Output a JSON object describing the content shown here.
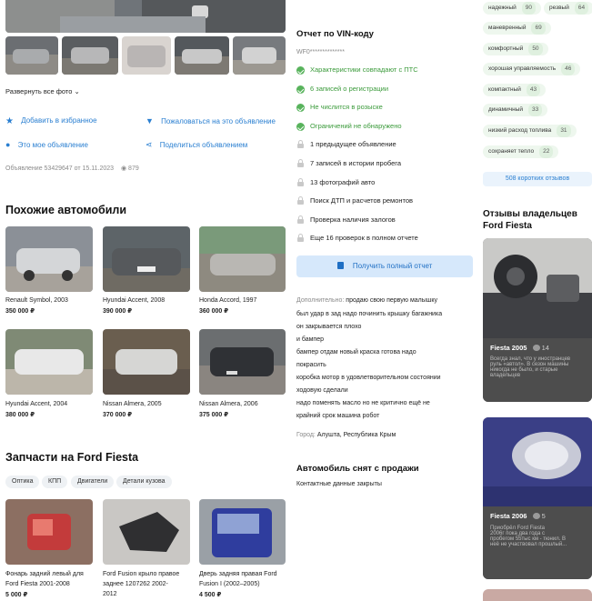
{
  "gallery": {
    "expand_label": "Развернуть все фото"
  },
  "actions": {
    "favorite": "Добавить в избранное",
    "complain": "Пожаловаться на это объявление",
    "my_ad": "Это мое объявление",
    "share": "Поделиться объявлением"
  },
  "meta": {
    "ad_info": "Объявление 53429647 от 15.11.2023",
    "views": "879"
  },
  "similar": {
    "title": "Похожие автомобили",
    "cars": [
      {
        "name": "Renault Symbol, 2003",
        "price": "350 000 ₽"
      },
      {
        "name": "Hyundai Accent, 2008",
        "price": "390 000 ₽"
      },
      {
        "name": "Honda Accord, 1997",
        "price": "360 000 ₽"
      },
      {
        "name": "Hyundai Accent, 2004",
        "price": "380 000 ₽"
      },
      {
        "name": "Nissan Almera, 2005",
        "price": "370 000 ₽"
      },
      {
        "name": "Nissan Almera, 2006",
        "price": "375 000 ₽"
      }
    ]
  },
  "parts": {
    "title": "Запчасти на Ford Fiesta",
    "chips": [
      "Оптика",
      "КПП",
      "Двигатели",
      "Детали кузова"
    ],
    "items": [
      {
        "name_l1": "Фонарь задний левый для",
        "name_l2": "Ford Fiesta 2001-2008",
        "price": "5 000 ₽"
      },
      {
        "name_l1": "Ford Fusion крыло правое",
        "name_l2": "заднее 1207262 2002-",
        "name_l3": "2012",
        "price": ""
      },
      {
        "name_l1": "Дверь задняя правая Ford",
        "name_l2": "Fusion I (2002–2005)",
        "price": "4 500 ₽"
      }
    ]
  },
  "vin": {
    "title": "Отчет по VIN-коду",
    "code": "WF0**************",
    "checks": [
      {
        "text": "Характеристики совпадают с ПТС",
        "ok": true
      },
      {
        "text": "6 записей о регистрации",
        "ok": true
      },
      {
        "text": "Не числится в розыске",
        "ok": true
      },
      {
        "text": "Ограничений не обнаружено",
        "ok": true
      },
      {
        "text": "1 предыдущее объявление",
        "ok": false
      },
      {
        "text": "7 записей в истории пробега",
        "ok": false
      },
      {
        "text": "13 фотографий авто",
        "ok": false
      },
      {
        "text": "Поиск ДТП и расчетов ремонтов",
        "ok": false
      },
      {
        "text": "Проверка наличия залогов",
        "ok": false
      },
      {
        "text": "Еще 16 проверок в полном отчете",
        "ok": false
      }
    ],
    "button": "Получить полный отчет"
  },
  "description": {
    "label": "Дополнительно:",
    "lines": [
      "продаю свою первую малышку",
      "был удар в зад надо починить крышку багажника",
      "он закрывается плохо",
      "и бампер",
      "бампер отдам новый краска готова надо",
      "покрасить",
      "коробка мотор в удовлетворительном состоянии",
      "ходовую сделали",
      "надо поменять масло но не критично ещё не",
      "крайний срок машина робот"
    ],
    "city_label": "Город:",
    "city": "Алушта, Республика Крым"
  },
  "removed": {
    "title": "Автомобиль снят с продажи",
    "subtitle": "Контактные данные закрыты"
  },
  "ratings": [
    {
      "label": "надежный",
      "value": "90"
    },
    {
      "label": "резвый",
      "value": "64"
    },
    {
      "label": "маневренный",
      "value": "69"
    },
    {
      "label": "комфортный",
      "value": "50"
    },
    {
      "label": "хорошая управляемость",
      "value": "46"
    },
    {
      "label": "компактный",
      "value": "43"
    },
    {
      "label": "динамичный",
      "value": "33"
    },
    {
      "label": "низкий расход топлива",
      "value": "31"
    },
    {
      "label": "сохраняет тепло",
      "value": "22"
    }
  ],
  "reviews": {
    "more_link": "508 коротких отзывов",
    "title_l1": "Отзывы владельцев",
    "title_l2": "Ford Fiesta",
    "cards": [
      {
        "title": "Fiesta 2005",
        "count": "14",
        "l1": "Всегда знал, что у иностранцев",
        "l2": "руль «автол». В сезон машины",
        "l3": "никогда не было, и старые",
        "l4": "владельцев"
      },
      {
        "title": "Fiesta 2006",
        "count": "5",
        "l1": "Приобрёл Ford Fiesta",
        "l2": "2006г пока два года с",
        "l3": "пробегом 55тыс км - тюнил. В",
        "l4": "неё не участвовал прошлый..."
      }
    ]
  }
}
